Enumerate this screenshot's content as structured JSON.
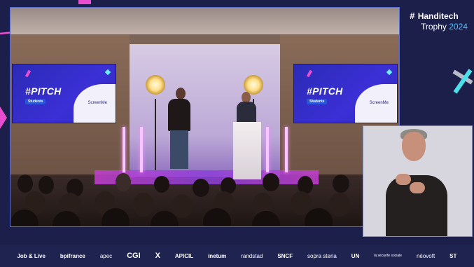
{
  "brand": {
    "hash": "#",
    "name": "Handitech",
    "sub_prefix": "Trophy ",
    "year": "2024"
  },
  "screens": [
    {
      "pitch": "#PITCH",
      "badge": "Students",
      "logo": "ScreenMe"
    },
    {
      "pitch": "#PITCH",
      "badge": "Students",
      "logo": "ScreenMe"
    }
  ],
  "sponsors": [
    "Job & Live",
    "bpifrance",
    "apec",
    "CGI",
    "X",
    "APICIL",
    "inetum",
    "randstad",
    "SNCF",
    "sopra steria",
    "UN",
    "la sécurité sociale",
    "néovoft",
    "ST"
  ],
  "colors": {
    "accent_pink": "#e84ccf",
    "accent_cyan": "#4cc3ff",
    "background": "#1c1f4a"
  }
}
